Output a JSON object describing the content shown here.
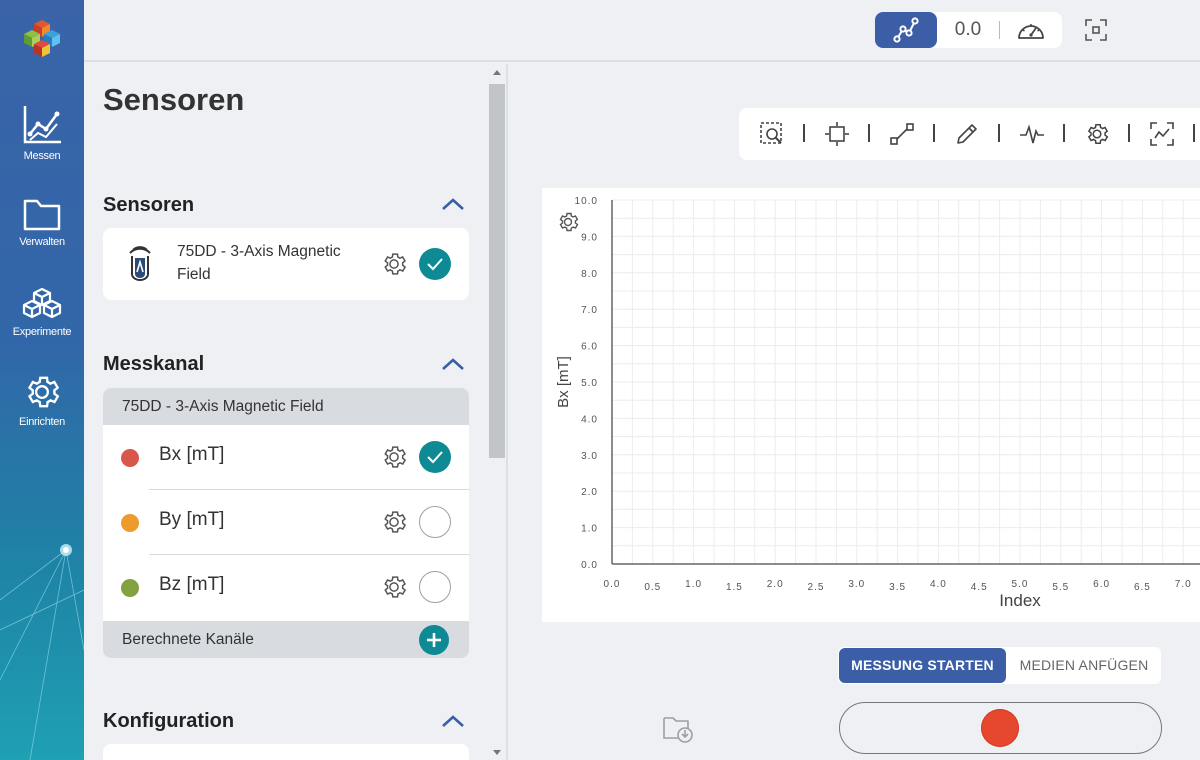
{
  "nav": {
    "items": [
      {
        "label": "Messen",
        "icon": "line-chart-icon"
      },
      {
        "label": "Verwalten",
        "icon": "folder-icon"
      },
      {
        "label": "Experimente",
        "icon": "cubes-icon"
      },
      {
        "label": "Einrichten",
        "icon": "gear-icon"
      }
    ]
  },
  "topbar": {
    "value": "0.0"
  },
  "panel": {
    "title": "Sensoren",
    "sensors": {
      "title": "Sensoren",
      "sensor_name": "75DD - 3-Axis Magnetic Field",
      "enabled": true
    },
    "channels": {
      "title": "Messkanal",
      "group": "75DD - 3-Axis Magnetic Field",
      "items": [
        {
          "name": "Bx [mT]",
          "color": "#d9574a",
          "checked": true
        },
        {
          "name": "By [mT]",
          "color": "#ee9a2c",
          "checked": false
        },
        {
          "name": "Bz [mT]",
          "color": "#83a13f",
          "checked": false
        }
      ],
      "computed": "Berechnete Kanäle"
    },
    "config": {
      "title": "Konfiguration"
    }
  },
  "actions": {
    "start": "MESSUNG STARTEN",
    "media": "MEDIEN ANFÜGEN"
  },
  "colors": {
    "accent": "#3b5ea7",
    "teal": "#0d8a94",
    "record": "#e5482e"
  },
  "chart_data": {
    "type": "line",
    "xlabel": "Index",
    "ylabel": "Bx [mT]",
    "xlim": [
      0,
      7.0
    ],
    "ylim": [
      0,
      10.0
    ],
    "x_ticks": [
      "0.0",
      "0.5",
      "1.0",
      "1.5",
      "2.0",
      "2.5",
      "3.0",
      "3.5",
      "4.0",
      "4.5",
      "5.0",
      "5.5",
      "6.0",
      "6.5",
      "7.0"
    ],
    "y_ticks": [
      "0.0",
      "1.0",
      "2.0",
      "3.0",
      "4.0",
      "5.0",
      "6.0",
      "7.0",
      "8.0",
      "9.0",
      "10.0"
    ],
    "grid": true,
    "series": []
  }
}
